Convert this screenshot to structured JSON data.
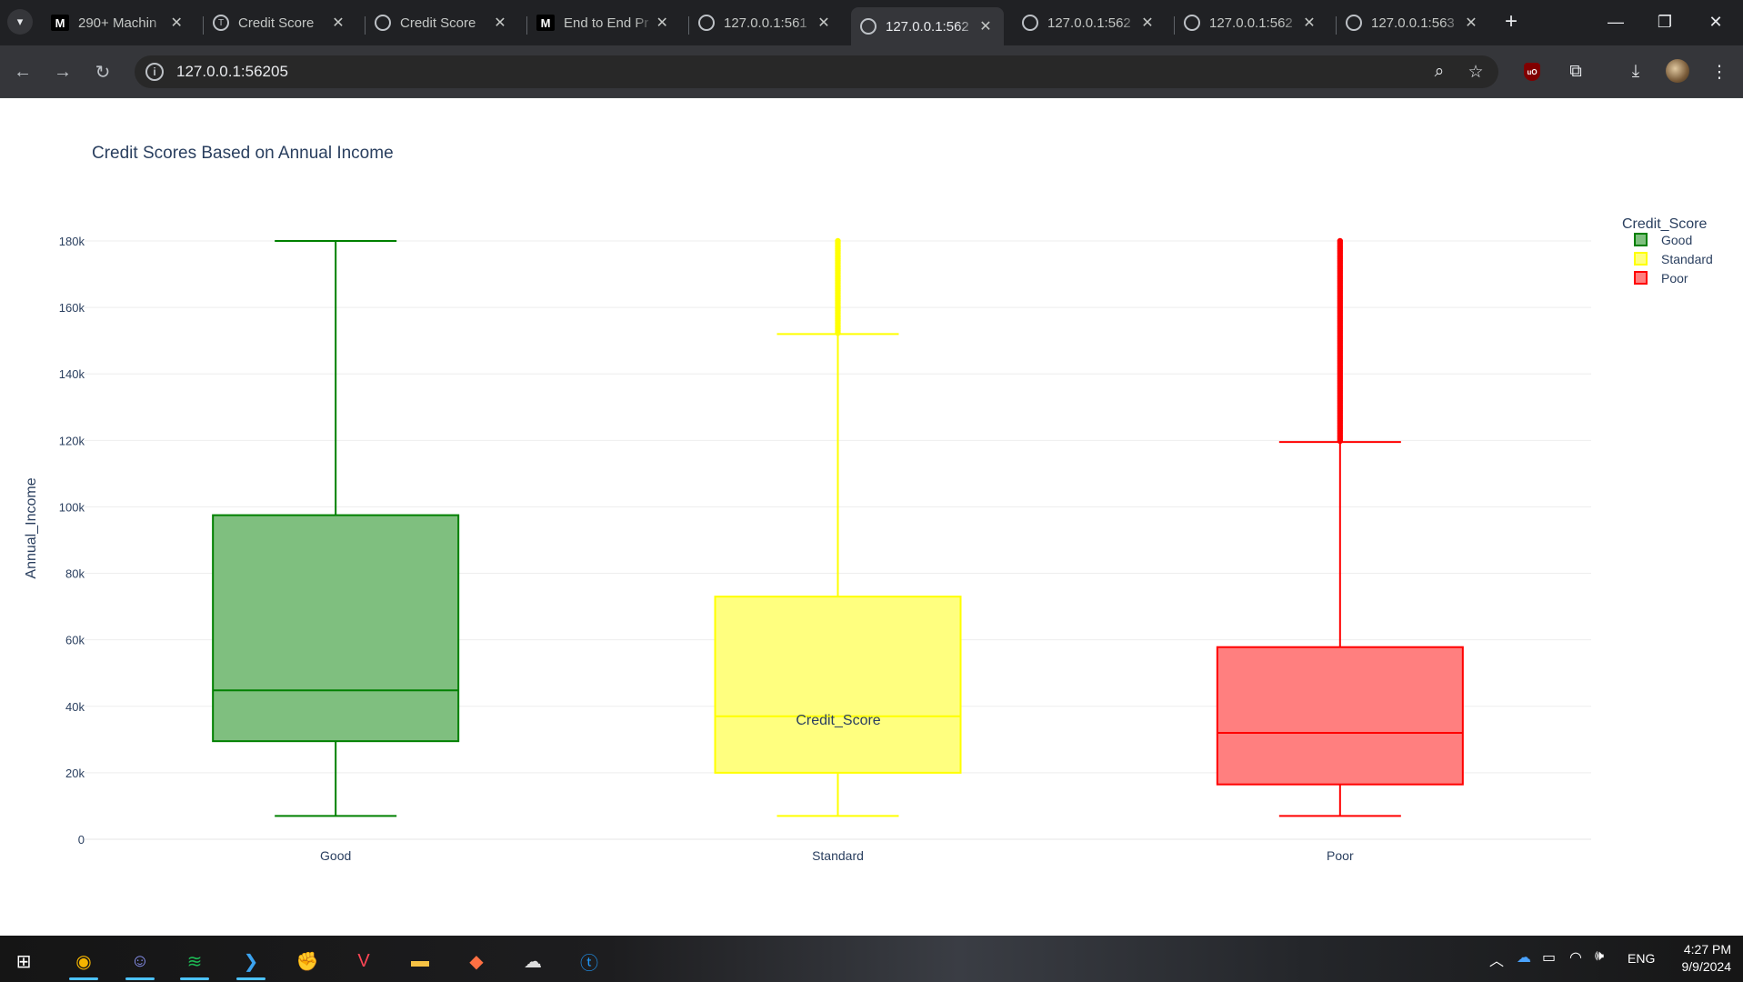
{
  "browser": {
    "tabs": [
      {
        "icon": "medium-icon",
        "fav_text": "M",
        "title": "290+ Machin"
      },
      {
        "icon": "t-logo-icon",
        "fav_text": "T",
        "title": "Credit Score"
      },
      {
        "icon": "chatgpt-icon",
        "fav_text": "",
        "title": "Credit Score"
      },
      {
        "icon": "medium-icon",
        "fav_text": "M",
        "title": "End to End Pr"
      },
      {
        "icon": "globe-icon",
        "fav_text": "",
        "title": "127.0.0.1:561"
      },
      {
        "icon": "globe-icon",
        "fav_text": "",
        "title": "127.0.0.1:562",
        "active": true
      },
      {
        "icon": "globe-icon",
        "fav_text": "",
        "title": "127.0.0.1:562"
      },
      {
        "icon": "globe-icon",
        "fav_text": "",
        "title": "127.0.0.1:562"
      },
      {
        "icon": "globe-icon",
        "fav_text": "",
        "title": "127.0.0.1:563"
      }
    ],
    "url": "127.0.0.1:56205"
  },
  "chart_data": {
    "type": "box",
    "title": "Credit Scores Based on Annual Income",
    "xlabel": "Credit_Score",
    "ylabel": "Annual_Income",
    "ylim": [
      0,
      180000
    ],
    "yticks": [
      0,
      20000,
      40000,
      60000,
      80000,
      100000,
      120000,
      140000,
      160000,
      180000
    ],
    "ytick_labels": [
      "0",
      "20k",
      "40k",
      "60k",
      "80k",
      "100k",
      "120k",
      "140k",
      "160k",
      "180k"
    ],
    "grid": true,
    "legend_title": "Credit_Score",
    "legend_position": "top-right",
    "categories": [
      "Good",
      "Standard",
      "Poor"
    ],
    "series": [
      {
        "name": "Good",
        "color": "#008000",
        "fill": "#7fbf7f",
        "min": 7000,
        "q1": 29500,
        "median": 44800,
        "q3": 97500,
        "max": 180000,
        "outliers_from": null,
        "outliers_to": null
      },
      {
        "name": "Standard",
        "color": "#ffff00",
        "fill": "#ffff7f",
        "min": 7000,
        "q1": 20000,
        "median": 37000,
        "q3": 73000,
        "max": 152000,
        "outliers_from": 152000,
        "outliers_to": 180000
      },
      {
        "name": "Poor",
        "color": "#ff0000",
        "fill": "#ff7f7f",
        "min": 7000,
        "q1": 16500,
        "median": 32000,
        "q3": 57800,
        "max": 119500,
        "outliers_from": 119500,
        "outliers_to": 180000
      }
    ]
  },
  "taskbar": {
    "apps": [
      "start-icon",
      "chrome-icon",
      "discord-icon",
      "spotify-icon",
      "vscode-icon",
      "riot-icon",
      "valorant-icon",
      "file-explorer-icon",
      "package-icon",
      "mouse-app-icon",
      "t-app-icon"
    ],
    "lang": "ENG",
    "time": "4:27 PM",
    "date": "9/9/2024"
  }
}
